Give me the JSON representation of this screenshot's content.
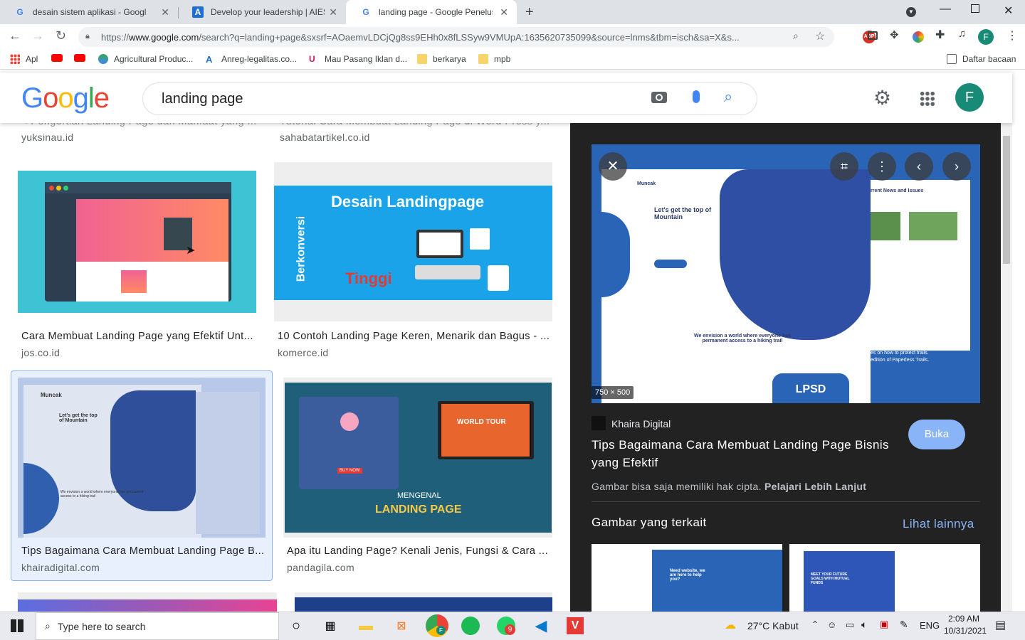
{
  "tabs": [
    {
      "title": "desain sistem aplikasi - Google Pe",
      "fav": "G"
    },
    {
      "title": "Develop your leadership | AIESEC",
      "fav": "A"
    },
    {
      "title": "landing page - Google Penelusur",
      "fav": "G"
    }
  ],
  "omnibox": {
    "url_host": "www.google.com",
    "url_pre": "https://",
    "url_rest": "/search?q=landing+page&sxsrf=AOaemvLDCjQg8ss9EHh0x8fLSSyw9VMUpA:1635620735099&source=lnms&tbm=isch&sa=X&s..."
  },
  "profile_initial": "F",
  "bookmarks": [
    {
      "label": "Apl"
    },
    {
      "label": ""
    },
    {
      "label": ""
    },
    {
      "label": "Agricultural Produc..."
    },
    {
      "label": "Anreg-legalitas.co..."
    },
    {
      "label": "Mau Pasang Iklan d..."
    },
    {
      "label": "berkarya"
    },
    {
      "label": "mpb"
    }
  ],
  "reading_list": "Daftar bacaan",
  "google": {
    "logo": "Google",
    "query": "landing page",
    "avatar": "F"
  },
  "results": [
    {
      "title": "< Pengertian Landing Page dan Manfaat yang ...",
      "src": "yuksinau.id"
    },
    {
      "title": "Tutorial Cara Membuat Landing Page di Word Press y...",
      "src": "sahabatartikel.co.id"
    },
    {
      "title": "Cara Membuat Landing Page yang Efektif Unt...",
      "src": "jos.co.id"
    },
    {
      "title": "10 Contoh Landing Page Keren, Menarik dan Bagus - ...",
      "src": "komerce.id"
    },
    {
      "title": "Tips Bagaimana Cara Membuat Landing Page B...",
      "src": "khairadigital.com"
    },
    {
      "title": "Apa itu Landing Page? Kenali Jenis, Fungsi & Cara ...",
      "src": "pandagila.com"
    }
  ],
  "thumb_text": {
    "desain": "Desain Landingpage",
    "berkonversi": "Berkonversi",
    "tinggi": "Tinggi",
    "muncak": "Muncak",
    "tagline": "Let's get the top of Mountain",
    "envision": "We envision a world  where everyone has permanent access to a hiking trail",
    "mengenal": "MENGENAL",
    "landing": "LANDING PAGE",
    "worldtour": "WORLD TOUR",
    "buynow": "BUY NOW"
  },
  "panel": {
    "dims": "750 × 500",
    "site": "Khaira Digital",
    "title": "Tips Bagaimana Cara Membuat Landing Page Bisnis yang Efektif",
    "copyright": "Gambar bisa saja memiliki hak cipta.",
    "learn": "Pelajari Lebih Lanjut",
    "open": "Buka",
    "related": "Gambar yang terkait",
    "more": "Lihat lainnya",
    "news": "rrent News and Issues",
    "trails": "es on how to protect trails.",
    "paperless": "edition of Paperless Trails.",
    "lpsd": "LPSD",
    "rel1": "Need website, we are here to help you?",
    "rel2": "MEET YOUR FUTURE GOALS WITH MUTUAL FUNDS"
  },
  "taskbar": {
    "search_placeholder": "Type here to search",
    "weather": "27°C  Kabut",
    "lang": "ENG",
    "time": "2:09 AM",
    "date": "10/31/2021",
    "chrome_badge": "F",
    "whatsapp_badge": "9"
  }
}
